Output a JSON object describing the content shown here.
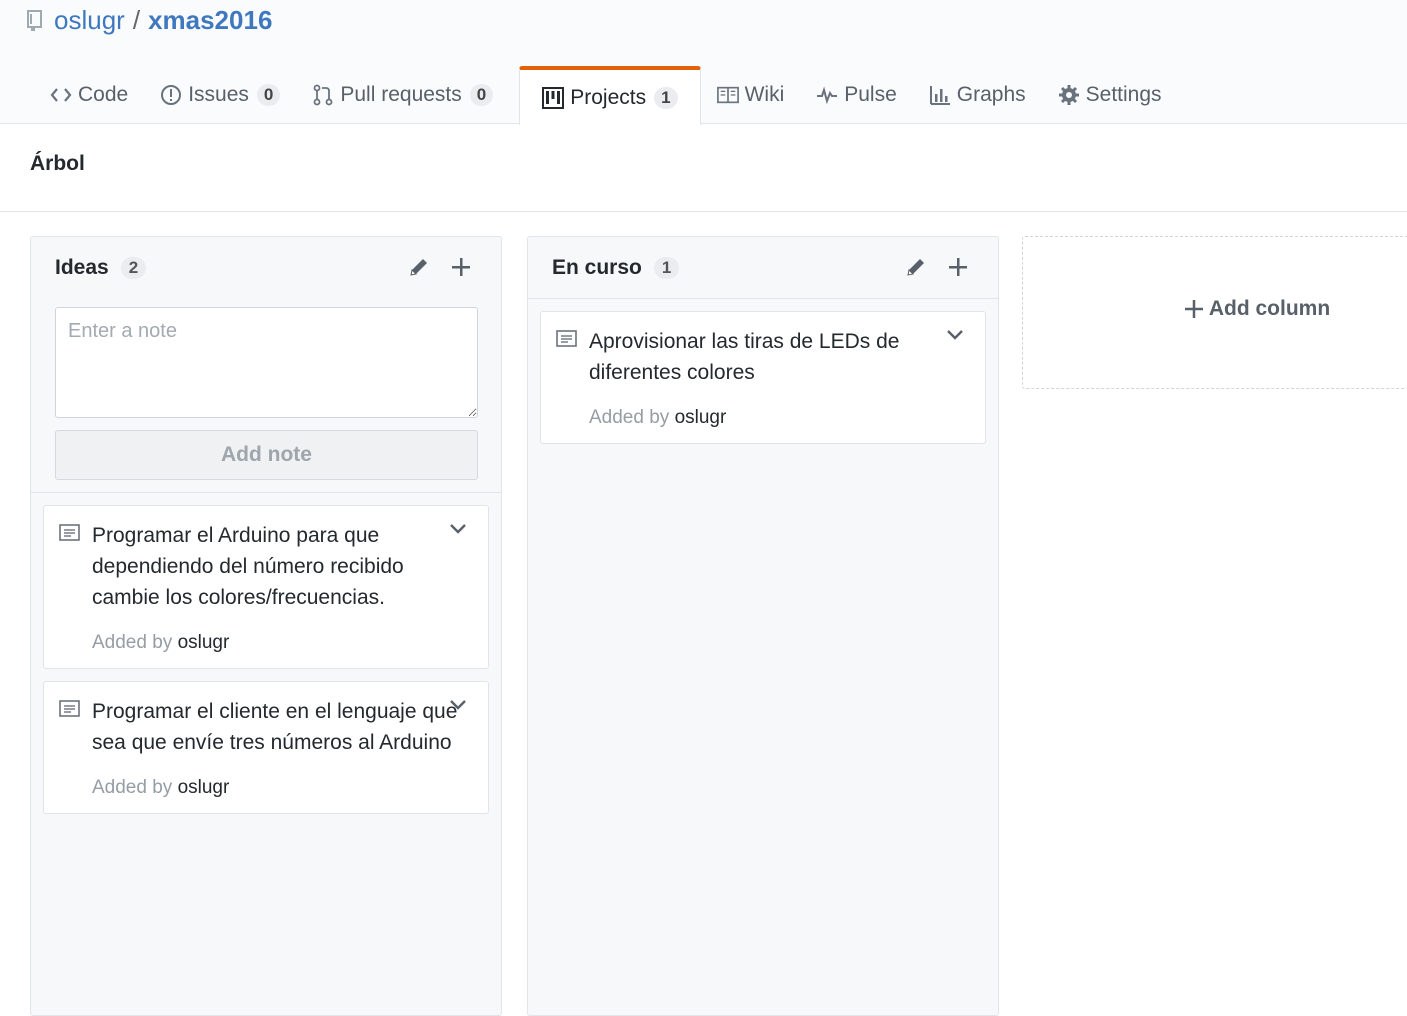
{
  "repo": {
    "owner": "oslugr",
    "separator": "/",
    "name": "xmas2016"
  },
  "tabs": [
    {
      "label": "Code",
      "icon": "code-icon",
      "counter": null
    },
    {
      "label": "Issues",
      "icon": "issue-icon",
      "counter": "0"
    },
    {
      "label": "Pull requests",
      "icon": "pull-request-icon",
      "counter": "0"
    },
    {
      "label": "Projects",
      "icon": "project-icon",
      "counter": "1",
      "selected": true
    },
    {
      "label": "Wiki",
      "icon": "book-icon",
      "counter": null
    },
    {
      "label": "Pulse",
      "icon": "pulse-icon",
      "counter": null
    },
    {
      "label": "Graphs",
      "icon": "graph-icon",
      "counter": null
    },
    {
      "label": "Settings",
      "icon": "gear-icon",
      "counter": null
    }
  ],
  "project": {
    "name": "Árbol"
  },
  "columns": [
    {
      "title": "Ideas",
      "count": "2",
      "note_form": {
        "placeholder": "Enter a note",
        "button": "Add note"
      },
      "cards": [
        {
          "text": "Programar el Arduino para que dependiendo del número recibido cambie los colores/frecuencias.",
          "added_by": "Added by",
          "author": "oslugr"
        },
        {
          "text": "Programar el cliente en el lenguaje que sea que envíe tres números al Arduino",
          "added_by": "Added by",
          "author": "oslugr"
        }
      ]
    },
    {
      "title": "En curso",
      "count": "1",
      "cards": [
        {
          "text": "Aprovisionar las tiras de LEDs de diferentes colores",
          "added_by": "Added by",
          "author": "oslugr"
        }
      ]
    }
  ],
  "add_column": {
    "label": "Add column"
  },
  "colors": {
    "link": "#4078c0",
    "selected_tab_border": "#e36209",
    "column_bg": "#f6f8fa"
  }
}
